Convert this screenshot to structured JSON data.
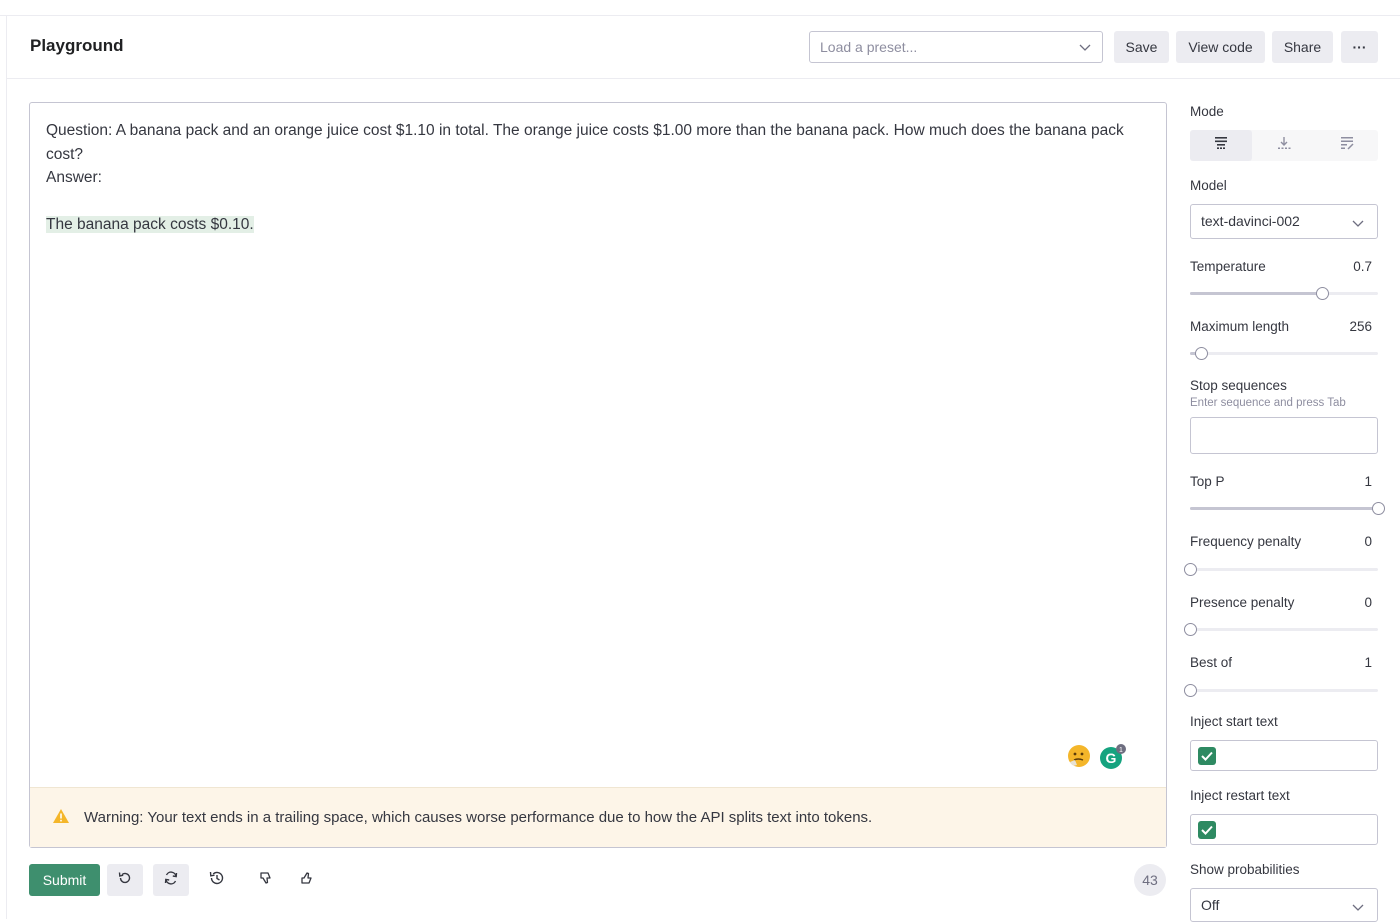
{
  "header": {
    "title": "Playground",
    "preset_placeholder": "Load a preset...",
    "save_label": "Save",
    "view_code_label": "View code",
    "share_label": "Share",
    "more_label": "···"
  },
  "editor": {
    "lines": [
      "Question: A banana pack and an orange juice cost $1.10 in total. The orange juice costs $1.00 more than the banana pack. How much does the banana pack cost?",
      "Answer:",
      ""
    ],
    "completion": "The banana pack costs $0.10.",
    "grammarly_badge": "1",
    "warning": "Warning: Your text ends in a trailing space, which causes worse performance due to how the API splits text into tokens."
  },
  "toolbar": {
    "submit_label": "Submit",
    "token_count": "43",
    "icons": [
      "undo-icon",
      "regenerate-icon",
      "history-icon",
      "thumbs-down-icon",
      "thumbs-up-icon"
    ]
  },
  "settings": {
    "mode_label": "Mode",
    "mode_icons": [
      "complete-icon",
      "insert-icon",
      "edit-icon"
    ],
    "model_label": "Model",
    "model_value": "text-davinci-002",
    "temperature": {
      "label": "Temperature",
      "value": "0.7",
      "level": 0.7
    },
    "max_length": {
      "label": "Maximum length",
      "value": "256",
      "level": 0.06
    },
    "stop_sequences": {
      "label": "Stop sequences",
      "hint": "Enter sequence and press Tab"
    },
    "top_p": {
      "label": "Top P",
      "value": "1",
      "level": 1.0
    },
    "frequency_penalty": {
      "label": "Frequency penalty",
      "value": "0",
      "level": 0
    },
    "presence_penalty": {
      "label": "Presence penalty",
      "value": "0",
      "level": 0
    },
    "best_of": {
      "label": "Best of",
      "value": "1",
      "level": 0
    },
    "inject_start": {
      "label": "Inject start text",
      "checked": true
    },
    "inject_restart": {
      "label": "Inject restart text",
      "checked": true
    },
    "show_probabilities": {
      "label": "Show probabilities",
      "value": "Off"
    }
  },
  "colors": {
    "accent": "#3e8f6e",
    "warning_bg": "#fdf5e8",
    "warning_icon": "#f4b62a"
  }
}
